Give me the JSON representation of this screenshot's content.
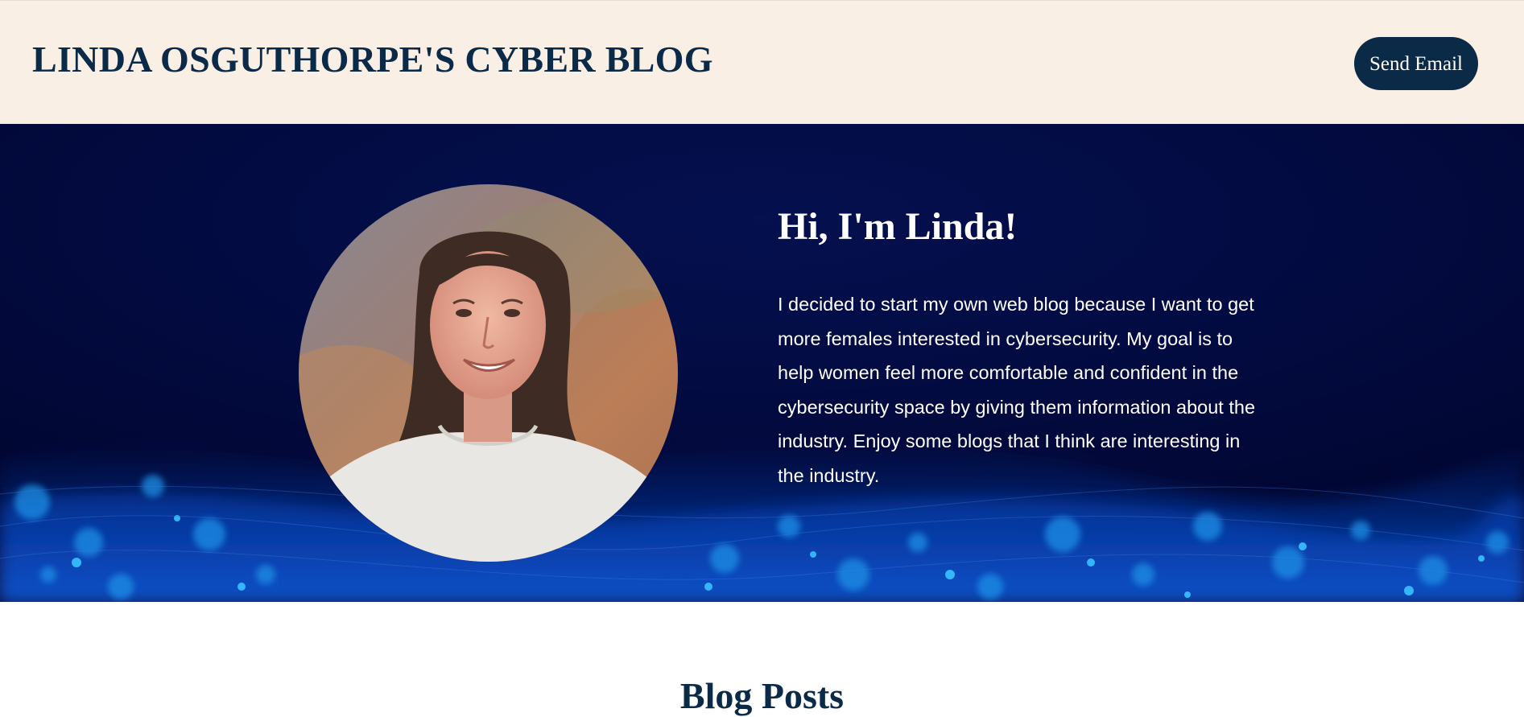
{
  "header": {
    "title": "LINDA OSGUTHORPE'S CYBER BLOG",
    "send_email_label": "Send Email"
  },
  "hero": {
    "heading": "Hi, I'm Linda!",
    "body": "I decided to start my own web blog because I want to get more females interested in cybersecurity. My goal is to help women feel more comfortable and confident in the cybersecurity space by giving them information about the industry. Enjoy some blogs that I think are interesting in the industry.",
    "portrait_icon": "portrait-photo"
  },
  "blog_section": {
    "title": "Blog Posts"
  },
  "colors": {
    "navy": "#0b2a47",
    "header_bg": "#faefe5",
    "hero_bg": "#020a40",
    "white": "#ffffff"
  }
}
